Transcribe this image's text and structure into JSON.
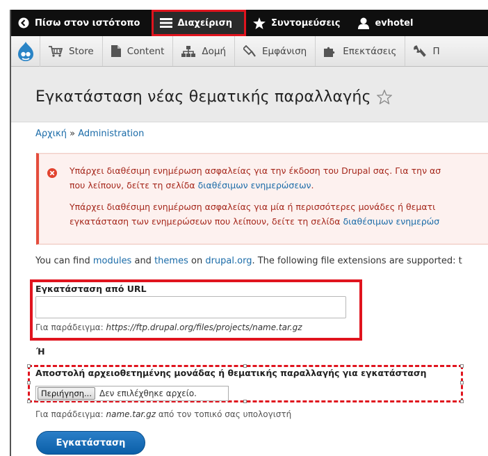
{
  "admin_bar": {
    "back_label": "Πίσω στον ιστότοπο",
    "manage_label": "Διαχείριση",
    "shortcuts_label": "Συντομεύσεις",
    "user_label": "evhotel"
  },
  "tray": {
    "items": [
      {
        "label": "Store",
        "icon": "cart-icon"
      },
      {
        "label": "Content",
        "icon": "document-icon"
      },
      {
        "label": "Δομή",
        "icon": "structure-icon"
      },
      {
        "label": "Εμφάνιση",
        "icon": "paint-icon"
      },
      {
        "label": "Επεκτάσεις",
        "icon": "puzzle-icon"
      },
      {
        "label": "Π",
        "icon": "wrench-icon"
      }
    ]
  },
  "page": {
    "title": "Εγκατάσταση νέας θεματικής παραλλαγής"
  },
  "breadcrumb": {
    "home": "Αρχική",
    "separator": "»",
    "current": "Administration"
  },
  "messages": {
    "msg1_line1": "Υπάρχει διαθέσιμη ενημέρωση ασφαλείας για την έκδοση του Drupal σας. Για την ασ",
    "msg1_line2_pre": "που λείπουν, δείτε τη σελίδα ",
    "msg1_link": "διαθέσιμων ενημερώσεων",
    "msg1_line2_post": ".",
    "msg2_line1": "Υπάρχει διαθέσιμη ενημέρωση ασφαλείας για μία ή περισσότερες μονάδες ή θεματι",
    "msg2_line2_pre": "εγκατάσταση των ενημερώσεων που λείπουν, δείτε τη σελίδα ",
    "msg2_link": "διαθέσιμων ενημερώσ"
  },
  "intro": {
    "pre": "You can find ",
    "modules_link": "modules",
    "and": " and ",
    "themes_link": "themes",
    "on": " on ",
    "drupal_link": "drupal.org",
    "post": ". The following file extensions are supported: t"
  },
  "url_section": {
    "label": "Εγκατάσταση από URL",
    "value": "",
    "hint_prefix": "Για παράδειγμα: ",
    "hint_example": "https://ftp.drupal.org/files/projects/name.tar.gz"
  },
  "or_label": "Ή",
  "upload_section": {
    "label": "Αποστολή αρχειοθετημένης μονάδας ή θεματικής παραλλαγής για εγκατάσταση",
    "browse_label": "Περιήγηση...",
    "no_file": "Δεν επιλέχθηκε αρχείο.",
    "hint_prefix": "Για παράδειγμα: ",
    "hint_example": "name.tar.gz",
    "hint_suffix": " από τον τοπικό σας υπολογιστή"
  },
  "install_button": "Εγκατάσταση",
  "colors": {
    "admin_bar_bg": "#0f0f0f",
    "highlight_red": "#e0141e",
    "link_blue": "#1a6ba8",
    "error_text": "#a5271b",
    "button_blue": "#0a5fa8"
  }
}
